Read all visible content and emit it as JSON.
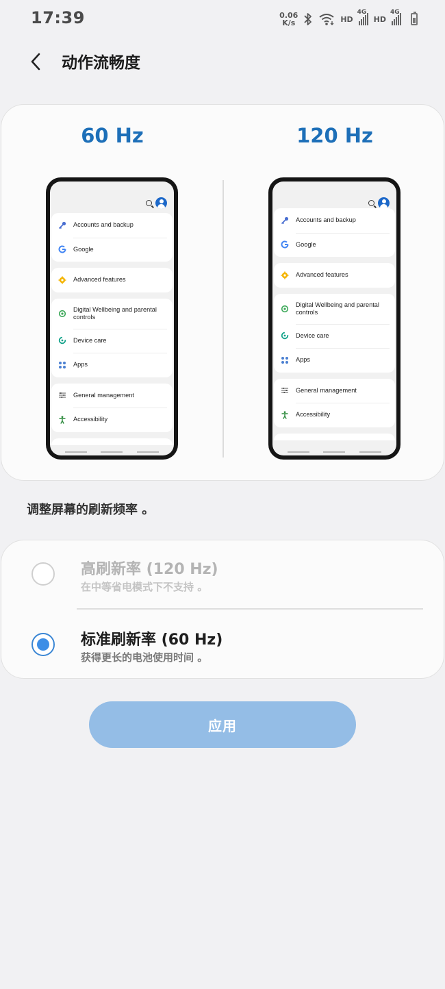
{
  "status_bar": {
    "time": "17:39",
    "net_speed_value": "0.06",
    "net_speed_unit": "K/s",
    "hd1": "HD",
    "net1": "4G",
    "hd2": "HD",
    "net2": "4G",
    "icons": [
      "bluetooth-icon",
      "wifi-icon",
      "signal-icon",
      "signal-icon",
      "battery-icon"
    ]
  },
  "header": {
    "title": "动作流畅度",
    "back_icon": "chevron-left-icon"
  },
  "preview": {
    "left_label": "60 Hz",
    "right_label": "120 Hz",
    "settings_items": [
      {
        "label": "Accounts and backup",
        "icon": "key-icon",
        "color": "#4a6fd1"
      },
      {
        "label": "Google",
        "icon": "google-icon",
        "color": "#4285f4"
      },
      {
        "label": "Advanced features",
        "icon": "gear-icon",
        "color": "#f4b400"
      },
      {
        "label": "Digital Wellbeing and parental controls",
        "icon": "wellbeing-icon",
        "color": "#3aa757"
      },
      {
        "label": "Device care",
        "icon": "device-care-icon",
        "color": "#14a38b"
      },
      {
        "label": "Apps",
        "icon": "apps-icon",
        "color": "#4a7fd1"
      },
      {
        "label": "General management",
        "icon": "sliders-icon",
        "color": "#555555"
      },
      {
        "label": "Accessibility",
        "icon": "accessibility-icon",
        "color": "#2e8b3e"
      }
    ]
  },
  "description": "调整屏幕的刷新频率 。",
  "options": {
    "high": {
      "title": "高刷新率 (120 Hz)",
      "subtitle": "在中等省电模式下不支持 。",
      "selected": false,
      "enabled": false
    },
    "standard": {
      "title": "标准刷新率 (60 Hz)",
      "subtitle": "获得更长的电池使用时间 。",
      "selected": true,
      "enabled": true
    }
  },
  "apply_button": "应用",
  "colors": {
    "accent": "#1d6fb8",
    "radio_selected": "#3d8ee6",
    "apply_button_bg": "#94bde6",
    "background": "#f1f1f3"
  }
}
